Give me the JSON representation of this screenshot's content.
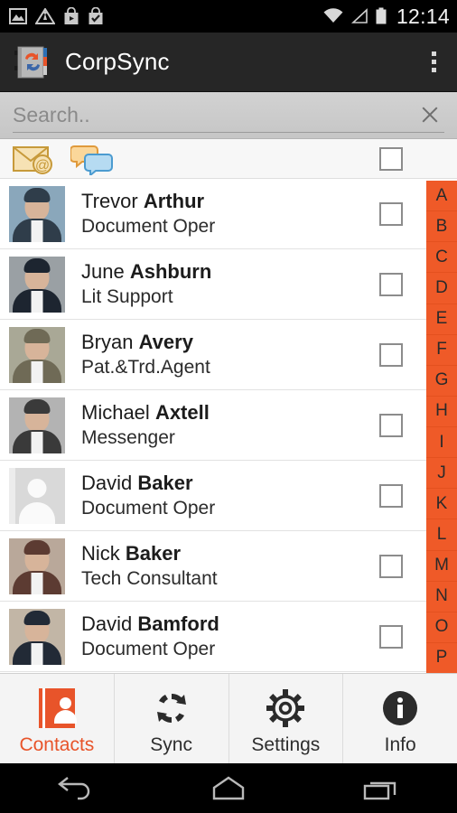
{
  "status_bar": {
    "time": "12:14",
    "left_icons": [
      "image-icon",
      "warning-triangle-icon",
      "play-store-icon",
      "app-installed-icon"
    ],
    "right_icons": [
      "wifi-icon",
      "signal-icon",
      "battery-icon"
    ]
  },
  "action_bar": {
    "app_name": "CorpSync",
    "app_icon": "corpsync-notebook-sync-icon",
    "overflow_label": "overflow-menu"
  },
  "search": {
    "placeholder": "Search..",
    "value": "",
    "clear_label": "clear-search"
  },
  "list_header": {
    "email_icon": "email-at-icon",
    "chat_icon": "chat-bubbles-icon",
    "select_all_checked": false
  },
  "contacts": [
    {
      "first": "Trevor",
      "last": "Arthur",
      "title": "Document Oper",
      "avatar": "photo",
      "checked": false
    },
    {
      "first": "June",
      "last": "Ashburn",
      "title": "Lit Support",
      "avatar": "photo",
      "checked": false
    },
    {
      "first": "Bryan",
      "last": "Avery",
      "title": "Pat.&Trd.Agent",
      "avatar": "photo",
      "checked": false
    },
    {
      "first": "Michael",
      "last": "Axtell",
      "title": "Messenger",
      "avatar": "photo",
      "checked": false
    },
    {
      "first": "David",
      "last": "Baker",
      "title": "Document Oper",
      "avatar": "placeholder",
      "checked": false
    },
    {
      "first": "Nick",
      "last": "Baker",
      "title": "Tech Consultant",
      "avatar": "photo",
      "checked": false
    },
    {
      "first": "David",
      "last": "Bamford",
      "title": "Document Oper",
      "avatar": "photo",
      "checked": false
    }
  ],
  "alpha_index": [
    "A",
    "B",
    "C",
    "D",
    "E",
    "F",
    "G",
    "H",
    "I",
    "J",
    "K",
    "L",
    "M",
    "N",
    "O",
    "P"
  ],
  "tabs": [
    {
      "label": "Contacts",
      "icon": "contacts-book-icon",
      "active": true
    },
    {
      "label": "Sync",
      "icon": "sync-arrows-icon",
      "active": false
    },
    {
      "label": "Settings",
      "icon": "gear-icon",
      "active": false
    },
    {
      "label": "Info",
      "icon": "info-circle-icon",
      "active": false
    }
  ],
  "nav_bar": {
    "back": "back-icon",
    "home": "home-icon",
    "recents": "recents-icon"
  },
  "colors": {
    "accent": "#ef5a28",
    "action_bar": "#262626",
    "status_bar": "#000000"
  }
}
